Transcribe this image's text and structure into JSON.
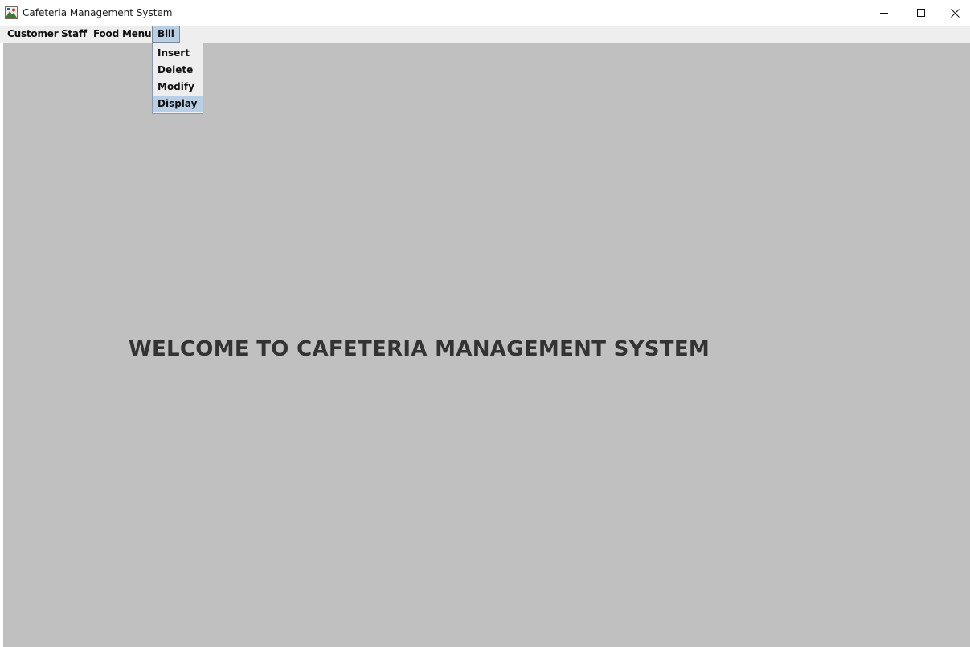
{
  "window": {
    "title": "Cafeteria Management System",
    "app_icon": "java-app-icon",
    "controls": {
      "minimize_icon": "minimize-icon",
      "maximize_icon": "maximize-icon",
      "close_icon": "close-icon"
    }
  },
  "menubar": {
    "items": [
      {
        "label": "Customer"
      },
      {
        "label": "Staff"
      },
      {
        "label": "Food Menu"
      },
      {
        "label": "Bill",
        "open": true
      }
    ]
  },
  "bill_menu": {
    "items": [
      {
        "label": "Insert"
      },
      {
        "label": "Delete"
      },
      {
        "label": "Modify"
      },
      {
        "label": "Display",
        "highlighted": true
      }
    ]
  },
  "main": {
    "welcome_text": "WELCOME TO CAFETERIA MANAGEMENT SYSTEM"
  },
  "colors": {
    "content_background": "#c0c0c0",
    "menubar_background": "#eeeeee",
    "selection_highlight": "#b8cfe5",
    "welcome_text": "#333333"
  }
}
